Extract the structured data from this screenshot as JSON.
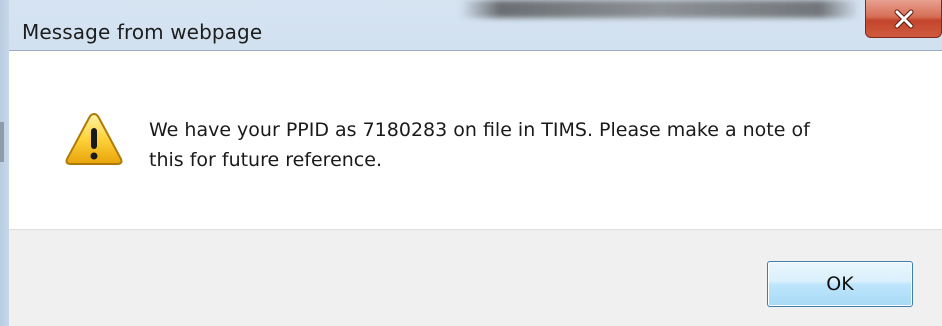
{
  "dialog": {
    "title": "Message from webpage",
    "message": "We have your PPID as 7180283 on file in TIMS.  Please make a note of\nthis for future reference.",
    "ok_label": "OK",
    "icon": "warning-icon",
    "close_icon": "close-icon"
  },
  "colors": {
    "titlebar": "#cbdbed",
    "close_button": "#c3452b",
    "button_bar": "#f0f0f0",
    "ok_button_border": "#3c7fb1"
  }
}
